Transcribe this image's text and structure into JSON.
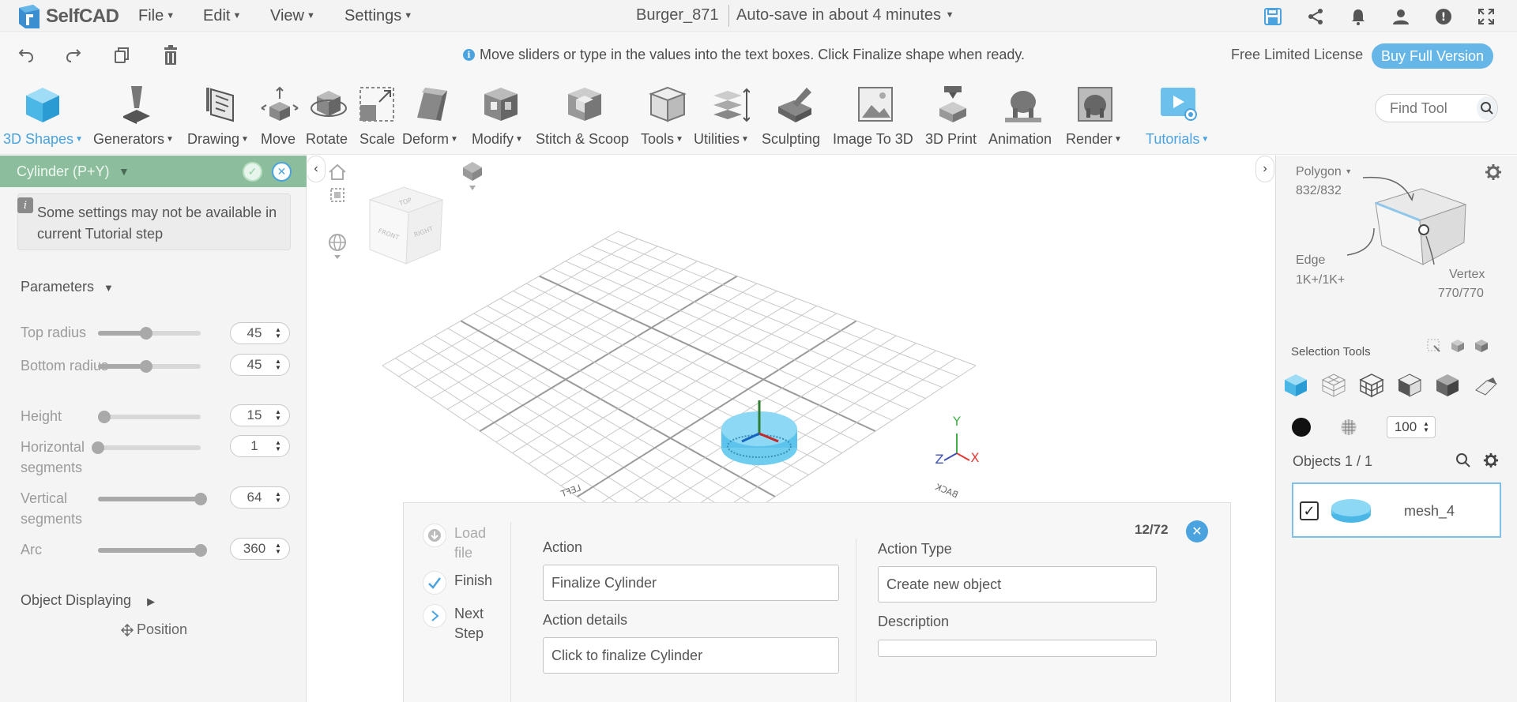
{
  "app": {
    "name": "SelfCAD"
  },
  "menus": [
    "File",
    "Edit",
    "View",
    "Settings"
  ],
  "document": {
    "title": "Burger_871",
    "autosave": "Auto-save in about 4 minutes"
  },
  "hint": {
    "text": "Move sliders or type in the values into the text boxes. Click Finalize shape when ready.",
    "info_icon": "i"
  },
  "license": {
    "text": "Free Limited License",
    "buy_label": "Buy Full Version"
  },
  "toolbar": {
    "tools": [
      "3D Shapes",
      "Generators",
      "Drawing",
      "Move",
      "Rotate",
      "Scale",
      "Deform",
      "Modify",
      "Stitch & Scoop",
      "Tools",
      "Utilities",
      "Sculpting",
      "Image To 3D",
      "3D Print",
      "Animation",
      "Render",
      "Tutorials"
    ],
    "find_placeholder": "Find Tool"
  },
  "left_panel": {
    "title": "Cylinder (P+Y)",
    "note": "Some settings may not be available in current Tutorial step",
    "note_icon": "i",
    "parameters_title": "Parameters",
    "params": [
      {
        "label": "Top radius",
        "value": "45",
        "slider_fraction": 0.47
      },
      {
        "label": "Bottom radius",
        "value": "45",
        "slider_fraction": 0.47
      },
      {
        "label": "Height",
        "value": "15",
        "slider_fraction": 0.06
      },
      {
        "label": "Horizontal segments",
        "value": "1",
        "slider_fraction": 0.0
      },
      {
        "label": "Vertical segments",
        "value": "64",
        "slider_fraction": 1.0
      },
      {
        "label": "Arc",
        "value": "360",
        "slider_fraction": 1.0
      }
    ],
    "object_displaying": "Object Displaying",
    "position_label": "Position"
  },
  "viewport": {
    "cube_labels": [
      "TOP",
      "FRONT",
      "RIGHT"
    ],
    "grid_labels": [
      "LEFT",
      "BACK"
    ],
    "axes": [
      "Y",
      "Z",
      "X"
    ]
  },
  "tutorial": {
    "steps": [
      "Load file",
      "Finish",
      "Next Step"
    ],
    "action_label": "Action",
    "action_value": "Finalize Cylinder",
    "action_details_label": "Action details",
    "action_details_value": "Click to finalize Cylinder",
    "action_type_label": "Action Type",
    "action_type_value": "Create new object",
    "description_label": "Description",
    "description_value": "",
    "counter": "12/72"
  },
  "right_panel": {
    "polygon_label": "Polygon",
    "polygon_count": "832/832",
    "edge_label": "Edge",
    "edge_count": "1K+/1K+",
    "vertex_label": "Vertex",
    "vertex_count": "770/770",
    "selection_tools_label": "Selection Tools",
    "opacity_value": "100",
    "objects_label": "Objects 1 / 1",
    "objects": [
      {
        "name": "mesh_4",
        "checked": true
      }
    ]
  },
  "colors": {
    "accent": "#4aa3df",
    "panel_header": "#8cbd9c",
    "object": "#5cc4ec"
  }
}
